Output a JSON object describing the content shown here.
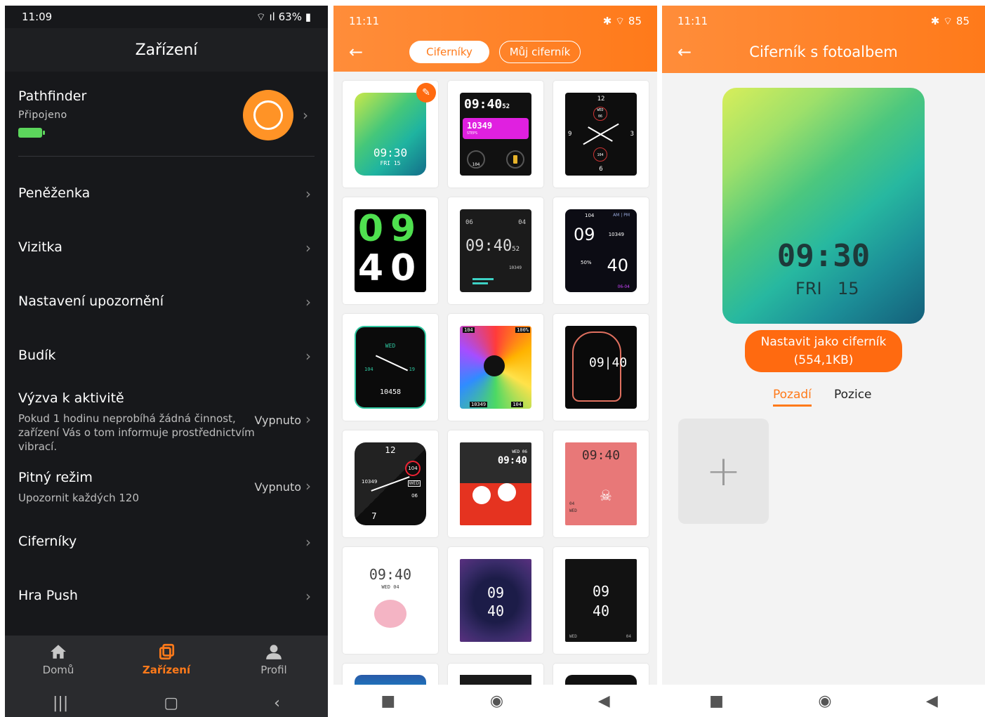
{
  "phone1": {
    "status": {
      "time": "11:09",
      "battery": "63%"
    },
    "title": "Zařízení",
    "device": {
      "name": "Pathfinder",
      "status": "Připojeno"
    },
    "menu": [
      {
        "label": "Peněženka"
      },
      {
        "label": "Vizitka"
      },
      {
        "label": "Nastavení upozornění"
      },
      {
        "label": "Budík"
      },
      {
        "label": "Výzva k aktivitě",
        "sub": "Pokud 1 hodinu neprobíhá žádná činnost, zařízení Vás o tom informuje prostřednictvím vibrací.",
        "value": "Vypnuto"
      },
      {
        "label": "Pitný režim",
        "sub": "Upozornit každých 120",
        "value": "Vypnuto"
      },
      {
        "label": "Ciferníky"
      },
      {
        "label": "Hra Push"
      }
    ],
    "tabs": [
      {
        "label": "Domů",
        "icon": "home-icon"
      },
      {
        "label": "Zařízení",
        "icon": "device-icon"
      },
      {
        "label": "Profil",
        "icon": "person-icon"
      }
    ],
    "accent": "#ff7a1a"
  },
  "phone2": {
    "status": {
      "time": "11:11",
      "battery": "85"
    },
    "tabs": {
      "active": "Ciferníky",
      "inactive": "Můj ciferník"
    },
    "faces": [
      {
        "time": "09:30",
        "day": "FRI 15"
      },
      {
        "time": "09:40",
        "sec": "52",
        "steps": "10349",
        "label": "STEPS",
        "hr": "104"
      },
      {
        "top": "12",
        "left": "9",
        "right": "3",
        "bottom": "6",
        "day": "WED",
        "date": "06",
        "hr": "104"
      },
      {
        "hour": "09",
        "min": "40"
      },
      {
        "time": "09:40",
        "sec": "52",
        "a": "06",
        "b": "04",
        "steps": "10349"
      },
      {
        "hour": "09",
        "min": "40",
        "hr": "104",
        "ampm": "AM | PM",
        "steps": "10349",
        "pct": "50%",
        "date": "06-04"
      },
      {
        "day": "WED",
        "hr": "104",
        "val": "19",
        "steps": "10458"
      },
      {
        "hr": "104",
        "pct": "100%",
        "steps": "10349",
        "hr2": "104"
      },
      {
        "time": "09|40"
      },
      {
        "top": "12",
        "hr": "104",
        "steps": "10349",
        "day": "WED",
        "date": "06",
        "bottom": "7"
      },
      {
        "date": "WED 06",
        "time": "09:40"
      },
      {
        "time": "09:40",
        "a": "04",
        "b": "WED"
      },
      {
        "time": "09:40",
        "date": "WED 04"
      },
      {
        "hour": "09",
        "min": "40"
      },
      {
        "hour": "09",
        "min": "40",
        "day": "WED",
        "date": "04"
      }
    ]
  },
  "phone3": {
    "status": {
      "time": "11:11",
      "battery": "85"
    },
    "title": "Ciferník s fotoalbem",
    "preview": {
      "time": "09:30",
      "day": "FRI",
      "date": "15"
    },
    "set_button": {
      "line1": "Nastavit jako ciferník",
      "line2": "(554,1KB)"
    },
    "tabs": {
      "active": "Pozadí",
      "inactive": "Pozice"
    },
    "add_label": "+"
  }
}
